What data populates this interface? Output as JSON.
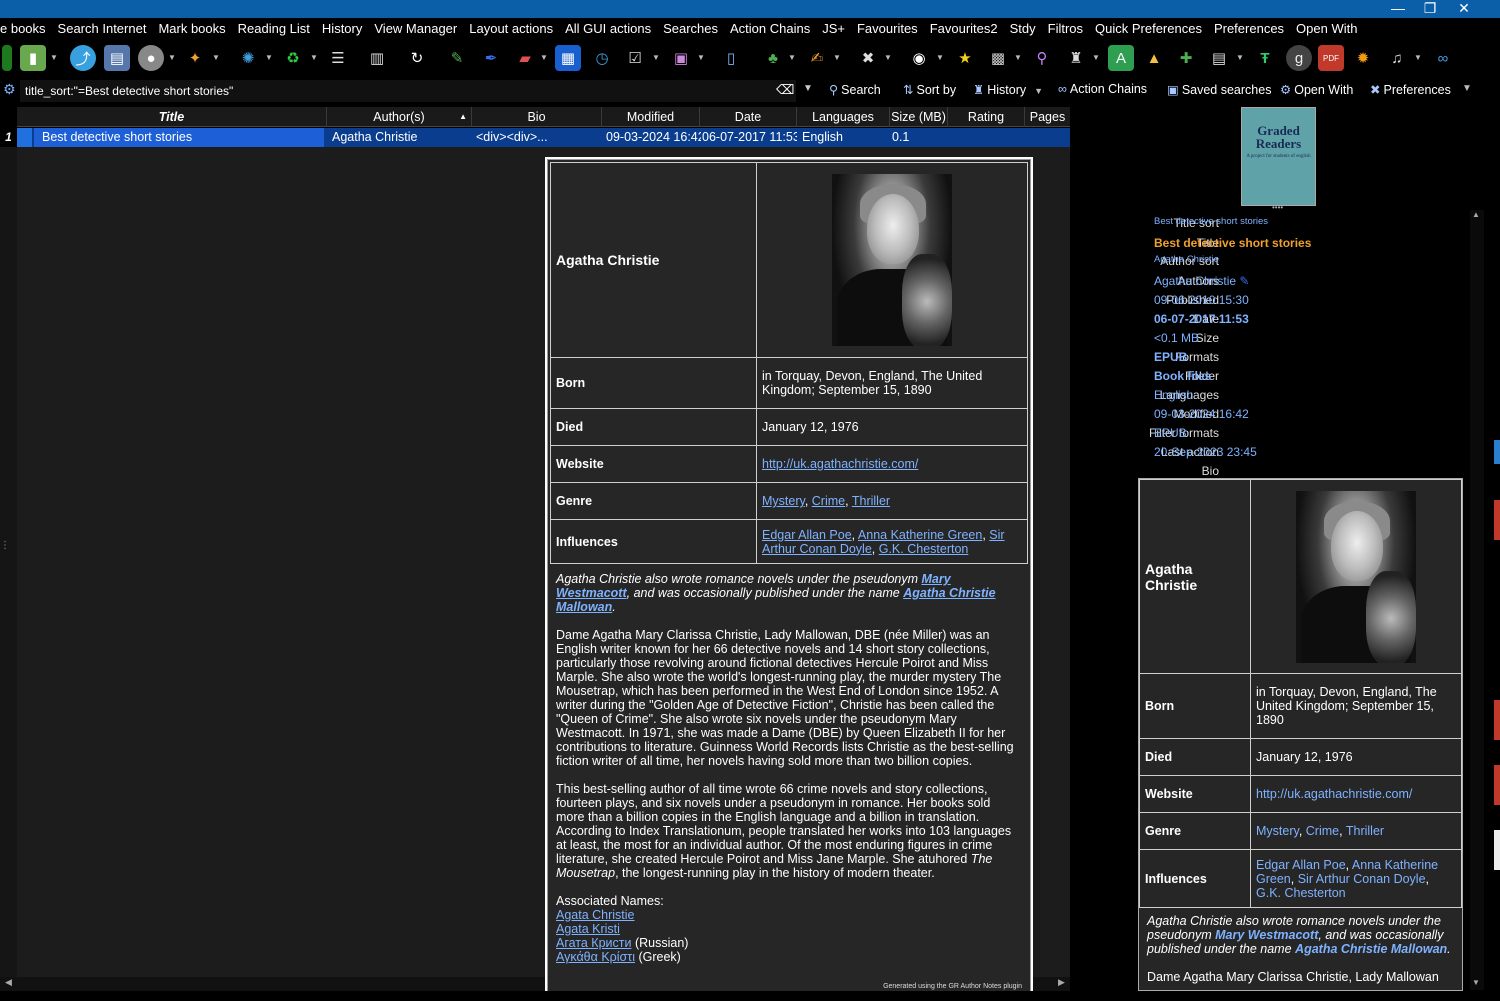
{
  "menu": [
    "e books",
    "Search Internet",
    "Mark books",
    "Reading List",
    "History",
    "View Manager",
    "Layout actions",
    "All GUI actions",
    "Searches",
    "Action Chains",
    "JS+",
    "Favourites",
    "Favourites2",
    "Stdy",
    "Filtros",
    "Quick Preferences",
    "Preferences",
    "Open With"
  ],
  "window_controls": {
    "minimize": "—",
    "restore": "❐",
    "close": "✕"
  },
  "search": {
    "query": "title_sort:\"=Best detective short stories\"",
    "buttons": {
      "search": "Search",
      "sort": "Sort by",
      "history": "History",
      "chains": "Action Chains",
      "saved": "Saved searches",
      "openwith": "Open With",
      "prefs": "Preferences"
    }
  },
  "columns": [
    "Title",
    "Author(s)",
    "Bio",
    "Modified",
    "Date",
    "Languages",
    "Size (MB)",
    "Rating",
    "Pages"
  ],
  "rows": [
    {
      "num": "1",
      "title": "Best detective short stories",
      "author": "Agatha Christie",
      "bio": "<div><div>...",
      "modified": "09-03-2024 16:42",
      "date": "06-07-2017 11:53",
      "language": "English",
      "size": "0.1",
      "rating": "",
      "pages": ""
    }
  ],
  "bio": {
    "name": "Agatha Christie",
    "born_label": "Born",
    "born": "in Torquay, Devon, England, The United Kingdom; September 15, 1890",
    "died_label": "Died",
    "died": "January 12, 1976",
    "website_label": "Website",
    "website": "http://uk.agathachristie.com/",
    "genre_label": "Genre",
    "genres": [
      "Mystery",
      "Crime",
      "Thriller"
    ],
    "influences_label": "Influences",
    "influences": [
      "Edgar Allan Poe",
      "Anna Katherine Green",
      "Sir Arthur Conan Doyle",
      "G.K. Chesterton"
    ],
    "pseudonym_prefix": "Agatha Christie also wrote romance novels under the pseudonym",
    "pseudonym1": "Mary Westmacott",
    "pseudonym_mid": ", and was occasionally published under the name",
    "pseudonym2": "Agatha Christie Mallowan",
    "paragraph1": "Dame Agatha Mary Clarissa Christie, Lady Mallowan, DBE (née Miller) was an English writer known for her 66 detective novels and 14 short story collections, particularly those revolving around fictional detectives Hercule Poirot and Miss Marple. She also wrote the world's longest-running play, the murder mystery The Mousetrap, which has been performed in the West End of London since 1952. A writer during the \"Golden Age of Detective Fiction\", Christie has been called the \"Queen of Crime\". She also wrote six novels under the pseudonym Mary Westmacott. In 1971, she was made a Dame (DBE) by Queen Elizabeth II for her contributions to literature. Guinness World Records lists Christie as the best-selling fiction writer of all time, her novels having sold more than two billion copies.",
    "paragraph2_a": "This best-selling author of all time wrote 66 crime novels and story collections, fourteen plays, and six novels under a pseudonym in romance. Her books sold more than a billion copies in the English language and a billion in translation. According to Index Translationum, people translated her works into 103 languages at least, the most for an individual author. Of the most enduring figures in crime literature, she created Hercule Poirot and Miss Jane Marple. She atuhored",
    "paragraph2_em": "The Mousetrap",
    "paragraph2_b": ", the longest-running play in the history of modern theater.",
    "assoc_label": "Associated Names:",
    "assoc": [
      {
        "name": "Agata Christie",
        "note": ""
      },
      {
        "name": "Agata Kristi",
        "note": ""
      },
      {
        "name": "Агата Кристи",
        "note": "(Russian)"
      },
      {
        "name": "Αγκάθα Κρίστι",
        "note": "(Greek)"
      }
    ],
    "footer": "Generated using the GR Author Notes plugin",
    "side_text_start": "Dame Agatha Mary Clarissa Christie, Lady Mallowan"
  },
  "cover": {
    "title": "Graded Readers",
    "subtitle": "A project for students of english"
  },
  "details": [
    {
      "k": "Title sort",
      "v": "Best detective short stories",
      "style": "small"
    },
    {
      "k": "Title",
      "v": "Best detective short stories",
      "style": "orange"
    },
    {
      "k": "Author sort",
      "v": "Agatha Christie",
      "style": "small"
    },
    {
      "k": "Authors",
      "v": "Agatha Christie",
      "style": "normal"
    },
    {
      "k": "Published",
      "v": "09-06-2010 15:30",
      "style": "normal"
    },
    {
      "k": "Date",
      "v": "06-07-2017 11:53",
      "style": "bold"
    },
    {
      "k": "Size",
      "v": "<0.1 MB",
      "style": "normal"
    },
    {
      "k": "Formats",
      "v": "EPUB",
      "style": "boldsmall"
    },
    {
      "k": "Folder",
      "v": "Book files",
      "style": "bold"
    },
    {
      "k": "Languages",
      "v": "English",
      "style": "normal"
    },
    {
      "k": "Modified",
      "v": "09-03-2024 16:42",
      "style": "normal"
    },
    {
      "k": "Filter formats",
      "v": "EPUB",
      "style": "normal"
    },
    {
      "k": "Last action",
      "v": "20-Sep-2023 23:45",
      "style": "normal"
    },
    {
      "k": "Bio",
      "v": "",
      "style": "normal"
    }
  ],
  "colors": {
    "accent": "#0a5fa8",
    "link": "#7fb2ff",
    "title_orange": "#f0a030",
    "row_selected": "#0b3d8f"
  }
}
